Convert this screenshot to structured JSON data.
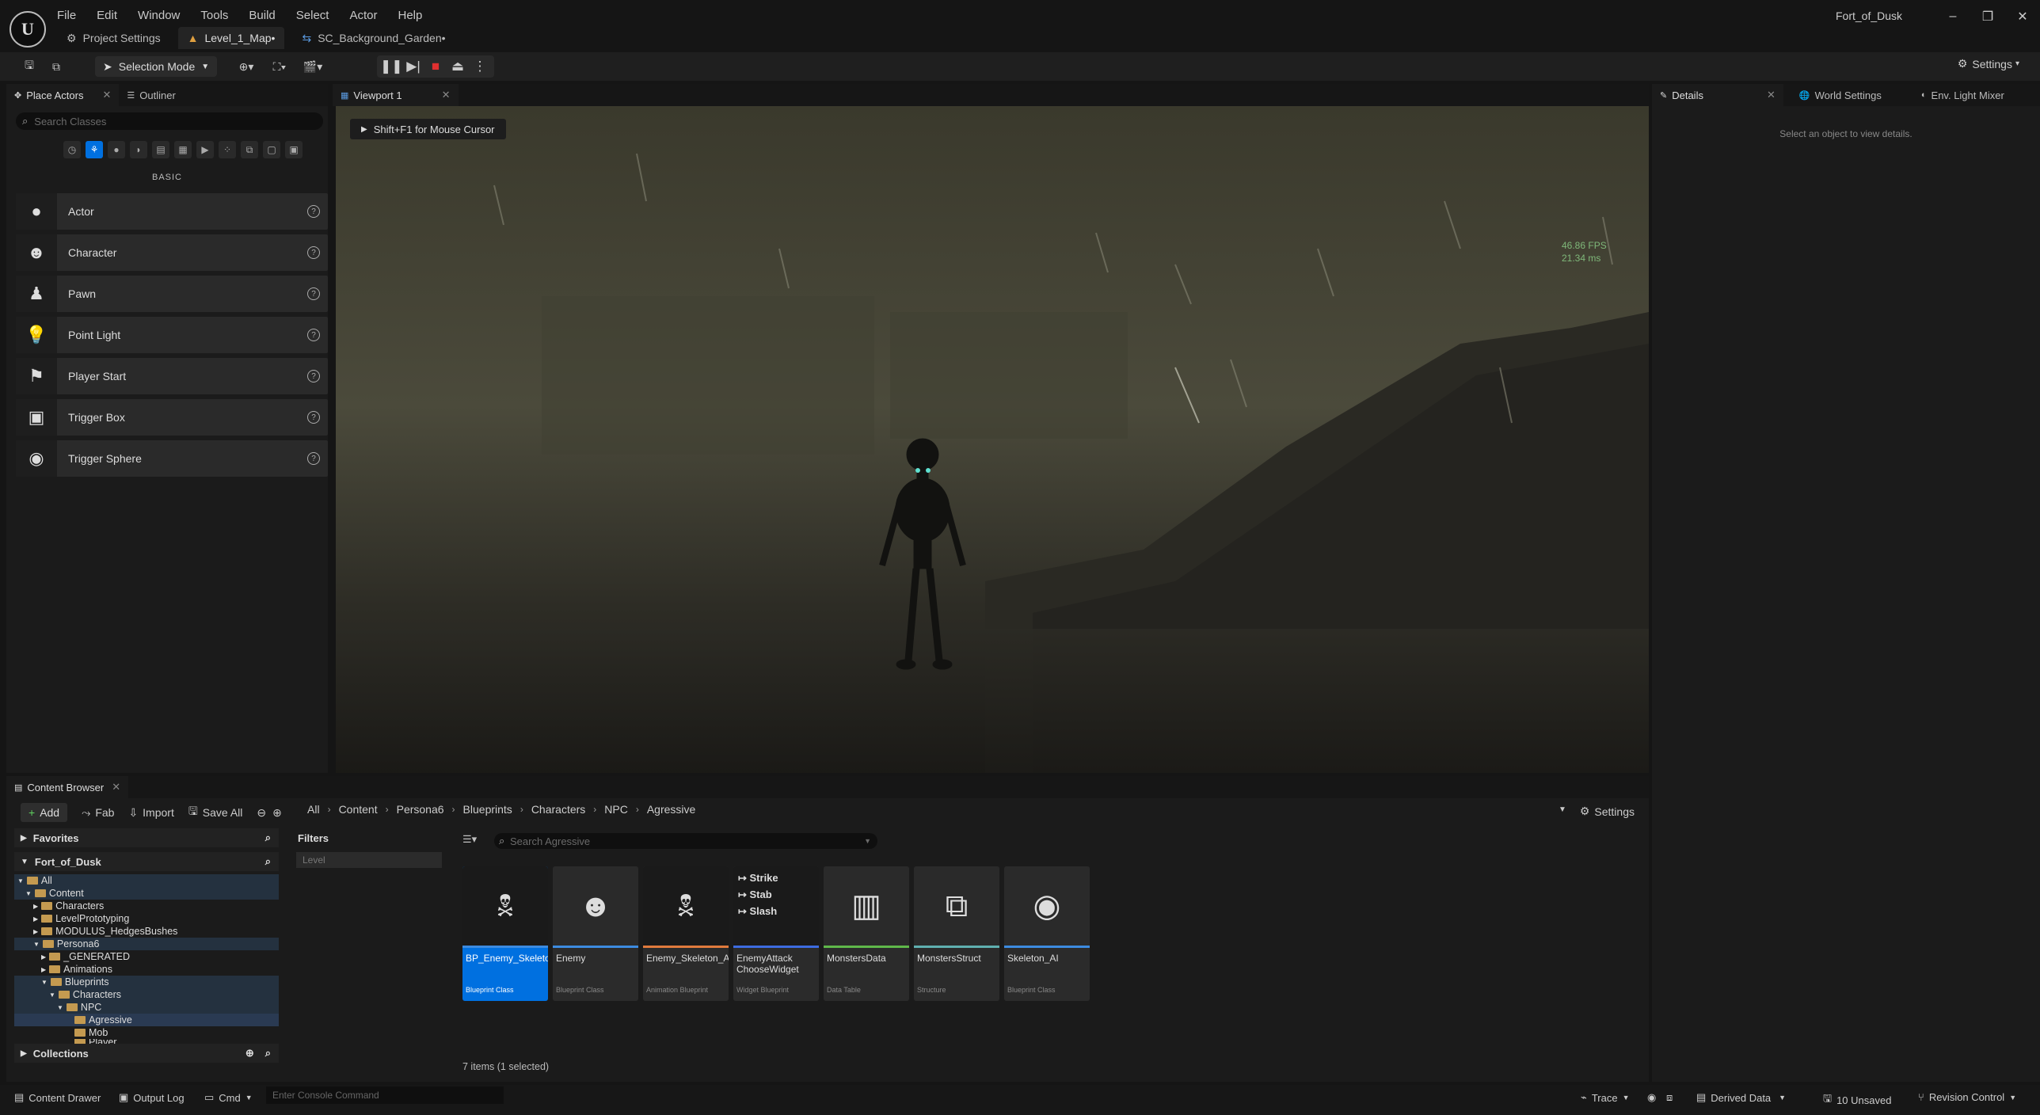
{
  "window": {
    "project_name": "Fort_of_Dusk",
    "controls": {
      "minimize": "–",
      "restore": "❐",
      "close": "✕"
    }
  },
  "menu": [
    "File",
    "Edit",
    "Window",
    "Tools",
    "Build",
    "Select",
    "Actor",
    "Help"
  ],
  "doc_tabs": [
    {
      "label": "Project Settings",
      "icon": "gear-icon"
    },
    {
      "label": "Level_1_Map•",
      "icon": "level-icon"
    },
    {
      "label": "SC_Background_Garden•",
      "icon": "sound-cue-icon"
    }
  ],
  "toolbar": {
    "selection_mode": "Selection Mode",
    "settings": "Settings"
  },
  "place_actors": {
    "tab_label": "Place Actors",
    "outliner_label": "Outliner",
    "search_placeholder": "Search Classes",
    "category": "BASIC",
    "items": [
      {
        "label": "Actor",
        "icon": "sphere-icon"
      },
      {
        "label": "Character",
        "icon": "character-icon"
      },
      {
        "label": "Pawn",
        "icon": "pawn-icon"
      },
      {
        "label": "Point Light",
        "icon": "point-light-icon"
      },
      {
        "label": "Player Start",
        "icon": "player-start-icon"
      },
      {
        "label": "Trigger Box",
        "icon": "trigger-box-icon"
      },
      {
        "label": "Trigger Sphere",
        "icon": "trigger-sphere-icon"
      }
    ]
  },
  "viewport": {
    "tab_label": "Viewport 1",
    "hint": "Shift+F1 for Mouse Cursor",
    "fps": "46.86 FPS",
    "ms": "21.34 ms"
  },
  "details": {
    "tabs": [
      "Details",
      "World Settings",
      "Env. Light Mixer"
    ],
    "empty_message": "Select an object to view details."
  },
  "content_browser": {
    "tab_label": "Content Browser",
    "add_label": "Add",
    "fab_label": "Fab",
    "import_label": "Import",
    "save_all_label": "Save All",
    "breadcrumb": [
      "All",
      "Content",
      "Persona6",
      "Blueprints",
      "Characters",
      "NPC",
      "Agressive"
    ],
    "settings_label": "Settings",
    "favorites_label": "Favorites",
    "project_root": "Fort_of_Dusk",
    "collections_label": "Collections",
    "filters_label": "Filters",
    "filter_chip": "Level",
    "search_placeholder": "Search Agressive",
    "tree": [
      "All",
      "Content",
      "Characters",
      "LevelPrototyping",
      "MODULUS_HedgesBushes",
      "Persona6",
      "_GENERATED",
      "Animations",
      "Blueprints",
      "Characters",
      "NPC",
      "Agressive",
      "Mob",
      "Player"
    ],
    "assets": [
      {
        "name": "BP_Enemy_Skeleton",
        "type": "Blueprint Class",
        "color": "#3d8be0",
        "selected": true
      },
      {
        "name": "Enemy",
        "type": "Blueprint Class",
        "color": "#3d8be0"
      },
      {
        "name": "Enemy_Skeleton_Anim",
        "type": "Animation Blueprint",
        "color": "#e07a3d"
      },
      {
        "name": "EnemyAttack ChooseWidget",
        "type": "Widget Blueprint",
        "color": "#3d6be0"
      },
      {
        "name": "MonstersData",
        "type": "Data Table",
        "color": "#5fb84a"
      },
      {
        "name": "MonstersStruct",
        "type": "Structure",
        "color": "#5fb0b0"
      },
      {
        "name": "Skeleton_AI",
        "type": "Blueprint Class",
        "color": "#3d8be0"
      }
    ],
    "widget_lines": [
      "Strike",
      "Stab",
      "Slash"
    ],
    "item_count": "7 items (1 selected)"
  },
  "statusbar": {
    "content_drawer": "Content Drawer",
    "output_log": "Output Log",
    "cmd": "Cmd",
    "console_placeholder": "Enter Console Command",
    "trace": "Trace",
    "derived_data": "Derived Data",
    "unsaved": "10 Unsaved",
    "revision_control": "Revision Control"
  }
}
